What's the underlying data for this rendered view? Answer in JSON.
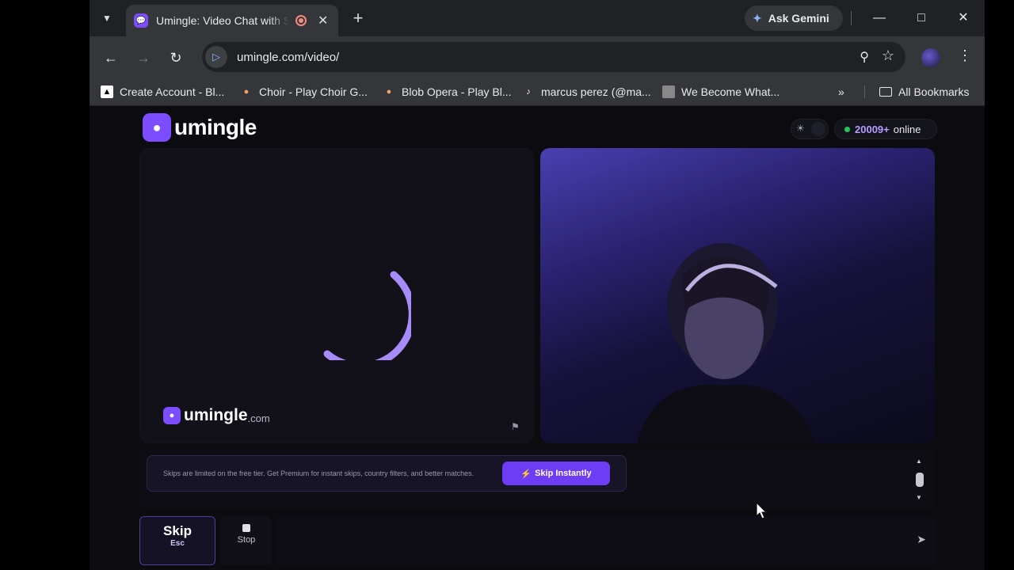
{
  "browser": {
    "tab_title": "Umingle: Video Chat with Strangers",
    "ask_gemini": "Ask Gemini",
    "url": "umingle.com/video/",
    "bookmarks": [
      {
        "label": "Create Account - Bl..."
      },
      {
        "label": "Choir - Play Choir G..."
      },
      {
        "label": "Blob Opera - Play Bl..."
      },
      {
        "label": "marcus perez (@ma..."
      },
      {
        "label": "We Become What..."
      }
    ],
    "all_bookmarks": "All Bookmarks"
  },
  "site": {
    "logo": "umingle",
    "online_count": "20009+",
    "online_label": "online",
    "watermark": "umingle",
    "watermark_tld": ".com"
  },
  "chat": {
    "notice": "Skips are limited on the free tier. Get Premium for instant skips, country filters, and better matches.",
    "skip_instantly": "Skip Instantly",
    "message_placeholder": ""
  },
  "controls": {
    "skip_label": "Skip",
    "skip_hint": "Esc",
    "stop_label": "Stop"
  },
  "colors": {
    "accent": "#7c4dff",
    "online_dot": "#22c55e"
  }
}
